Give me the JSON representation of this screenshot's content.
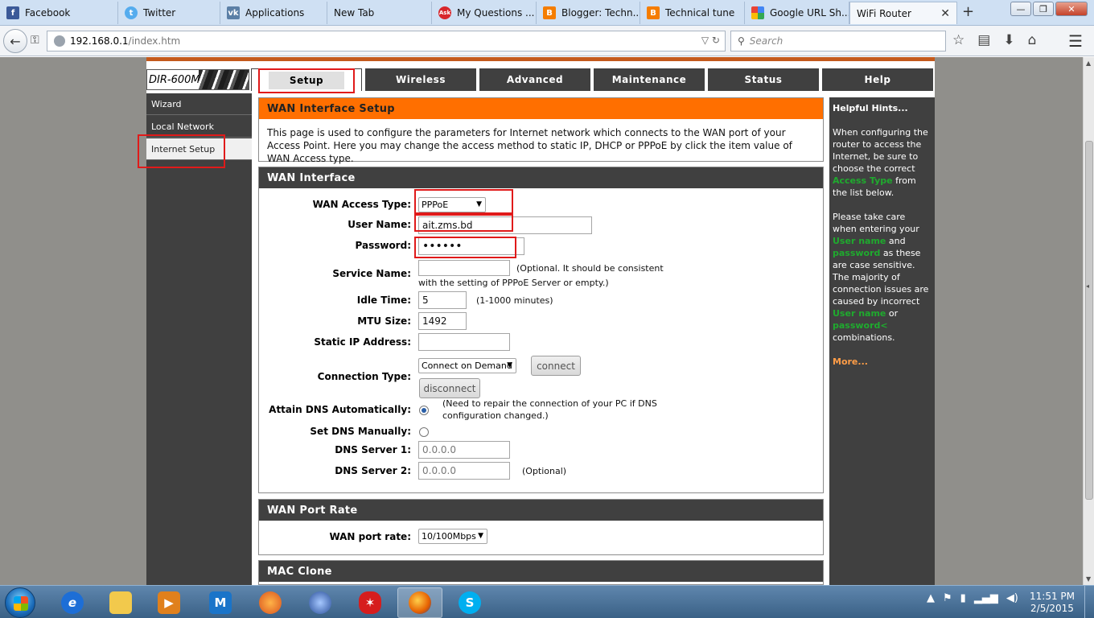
{
  "browser": {
    "tabs": [
      {
        "label": "Facebook",
        "icon": "facebook-icon"
      },
      {
        "label": "Twitter",
        "icon": "twitter-icon"
      },
      {
        "label": "Applications",
        "icon": "vk-icon"
      },
      {
        "label": "New Tab",
        "icon": ""
      },
      {
        "label": "My Questions ...",
        "icon": "ask-icon"
      },
      {
        "label": "Blogger: Techn...",
        "icon": "blogger-icon"
      },
      {
        "label": "Technical tune",
        "icon": "blogger-icon"
      },
      {
        "label": "Google URL Sh...",
        "icon": "google-icon"
      },
      {
        "label": "WiFi Router",
        "icon": ""
      }
    ],
    "new_tab": "+",
    "url_host": "192.168.0.1",
    "url_path": "/index.htm",
    "search_placeholder": "Search"
  },
  "router": {
    "logo": "DIR-600M",
    "top_menu": [
      "Setup",
      "Wireless",
      "Advanced",
      "Maintenance",
      "Status",
      "Help"
    ],
    "left_menu": [
      "Wizard",
      "Local Network",
      "Internet Setup"
    ],
    "page_title": "WAN Interface Setup",
    "intro": "This page is used to configure the parameters for Internet network which connects to the WAN port of your Access Point. Here you may change the access method to static IP, DHCP or PPPoE by click the item value of WAN Access type.",
    "wan": {
      "heading": "WAN Interface",
      "access_type_label": "WAN Access Type:",
      "access_type_value": "PPPoE",
      "username_label": "User Name:",
      "username_value": "ait.zms.bd",
      "password_label": "Password:",
      "password_value": "••••••",
      "service_label": "Service Name:",
      "service_note_1": "(Optional. It should be consistent",
      "service_note_2": "with the setting of PPPoE Server or empty.)",
      "idle_label": "Idle Time:",
      "idle_value": "5",
      "idle_note": "(1-1000 minutes)",
      "mtu_label": "MTU Size:",
      "mtu_value": "1492",
      "static_ip_label": "Static IP Address:",
      "conn_type_label": "Connection Type:",
      "conn_type_value": "Connect on Demand",
      "connect_btn": "connect",
      "disconnect_btn": "disconnect",
      "dns_auto_label": "Attain DNS Automatically:",
      "dns_auto_note_1": "(Need to repair the connection of your PC if DNS",
      "dns_auto_note_2": "configuration changed.)",
      "dns_manual_label": "Set DNS Manually:",
      "dns1_label": "DNS Server 1:",
      "dns1_value": "0.0.0.0",
      "dns2_label": "DNS Server 2:",
      "dns2_value": "0.0.0.0",
      "dns2_note": "(Optional)"
    },
    "port_rate": {
      "heading": "WAN Port Rate",
      "label": "WAN port rate:",
      "value": "10/100Mbps"
    },
    "mac_clone": {
      "heading": "MAC Clone"
    },
    "hints": {
      "title": "Helpful Hints...",
      "p1_a": "When configuring the router to access the Internet, be sure to choose the correct ",
      "p1_b": "Access Type",
      "p1_c": " from the list below.",
      "p2_a": "Please take care when entering your ",
      "p2_b": "User name",
      "p2_c": " and ",
      "p2_d": "password",
      "p2_e": " as these are case sensitive. The majority of connection issues are caused by incorrect ",
      "p2_f": "User name",
      "p2_g": " or ",
      "p2_h": "password<",
      "p2_i": " combinations.",
      "more": "More..."
    }
  },
  "taskbar": {
    "time": "11:51 PM",
    "date": "2/5/2015"
  }
}
